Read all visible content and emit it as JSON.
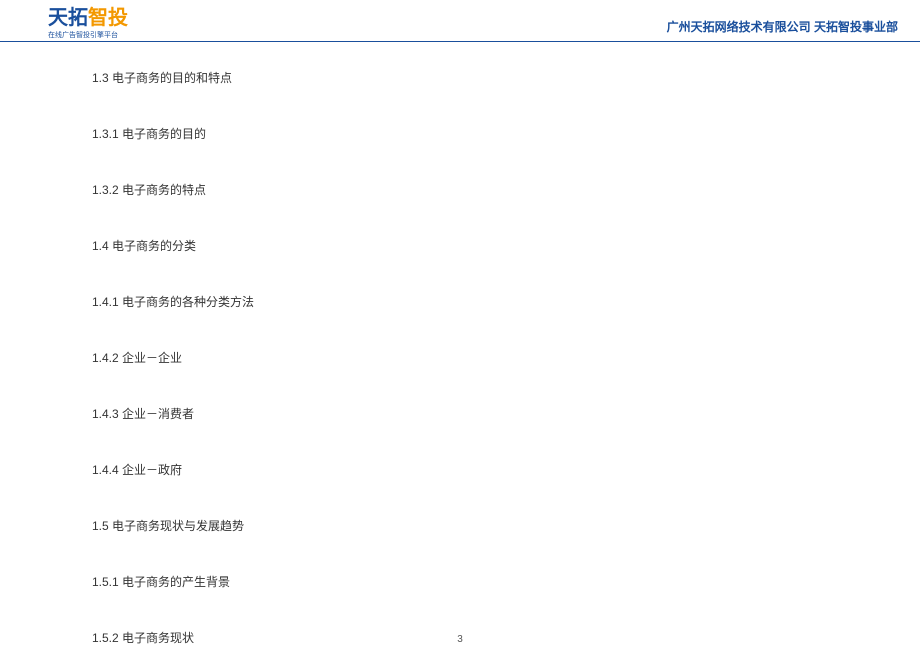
{
  "header": {
    "logo_main_part1": "天拓",
    "logo_main_part2": "智投",
    "logo_sub": "在线广告智投引擎平台",
    "company": "广州天拓网络技术有限公司  天拓智投事业部"
  },
  "toc": [
    "1.3  电子商务的目的和特点",
    "1.3.1  电子商务的目的",
    "1.3.2  电子商务的特点",
    "1.4  电子商务的分类",
    "1.4.1  电子商务的各种分类方法",
    "1.4.2  企业－企业",
    "1.4.3  企业－消费者",
    "1.4.4  企业－政府",
    "1.5  电子商务现状与发展趋势",
    "1.5.1  电子商务的产生背景",
    "1.5.2  电子商务现状"
  ],
  "page_number": "3"
}
